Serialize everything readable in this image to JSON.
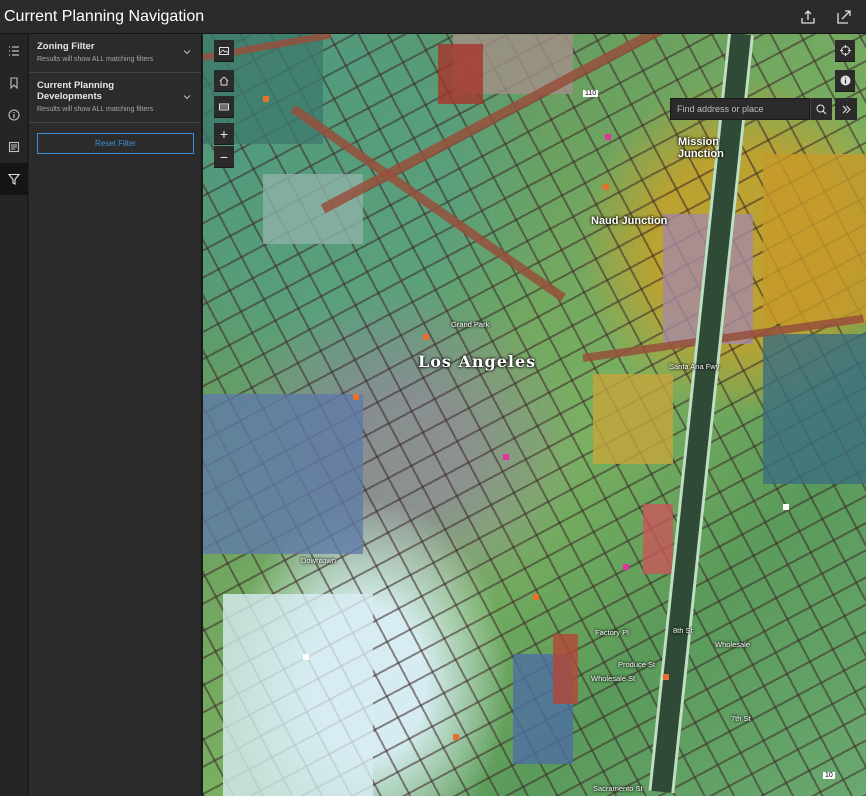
{
  "header": {
    "title": "Current Planning Navigation"
  },
  "rail": {
    "items": [
      {
        "name": "layers"
      },
      {
        "name": "bookmarks"
      },
      {
        "name": "info"
      },
      {
        "name": "legend"
      },
      {
        "name": "filter",
        "active": true
      }
    ]
  },
  "panel": {
    "filters": [
      {
        "title": "Zoning Filter",
        "subtitle": "Results will show ALL matching filters"
      },
      {
        "title": "Current Planning Developments",
        "subtitle": "Results will show ALL matching filters"
      }
    ],
    "reset_label": "Reset Filter"
  },
  "map": {
    "search_placeholder": "Find address or place",
    "labels": {
      "city": "Los Angeles",
      "naud_junction": "Naud Junction",
      "mission_junction": "Mission Junction",
      "downtown": "Downtown",
      "wholesale": "Wholesale",
      "factory_pl": "Factory Pl",
      "produce_st": "Produce St",
      "wholesale_st": "Wholesale St",
      "eighth_st": "8th St",
      "seventh_st": "7th St",
      "sacramento_st": "Sacramento St",
      "santa_ana_fwy": "Santa Ana Fwy",
      "grand_park": "Grand Park",
      "highway_110": "110",
      "highway_10": "10"
    }
  },
  "colors": {
    "accent": "#3c8fd8",
    "header_bg": "#2b2b2b",
    "panel_bg": "#2b2b2b"
  }
}
